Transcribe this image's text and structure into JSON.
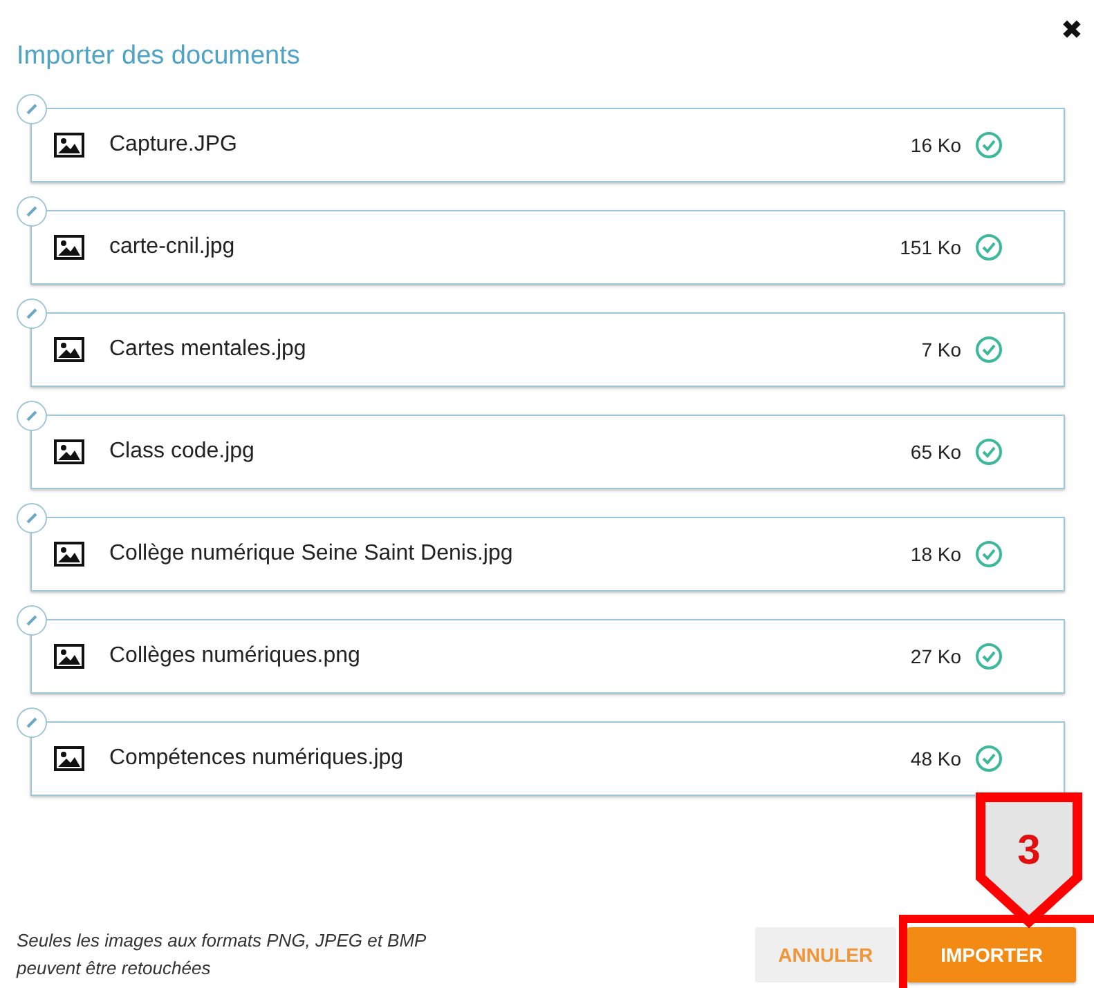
{
  "dialog": {
    "title": "Importer des documents",
    "close": "✖"
  },
  "files": [
    {
      "name": "Capture.JPG",
      "size": "16 Ko",
      "done": true
    },
    {
      "name": "carte-cnil.jpg",
      "size": "151 Ko",
      "done": true
    },
    {
      "name": "Cartes mentales.jpg",
      "size": "7 Ko",
      "done": true
    },
    {
      "name": "Class code.jpg",
      "size": "65 Ko",
      "done": true
    },
    {
      "name": "Collège numérique Seine Saint Denis.jpg",
      "size": "18 Ko",
      "done": true
    },
    {
      "name": "Collèges numériques.png",
      "size": "27 Ko",
      "done": true
    },
    {
      "name": "Compétences numériques.jpg",
      "size": "48 Ko",
      "done": true
    }
  ],
  "note": "Seules les images aux formats PNG, JPEG et BMP peuvent être retouchées",
  "buttons": [
    {
      "label": "ANNULER",
      "kind": "secondary"
    },
    {
      "label": "IMPORTER",
      "kind": "primary"
    }
  ],
  "annotation": {
    "label": "3"
  }
}
